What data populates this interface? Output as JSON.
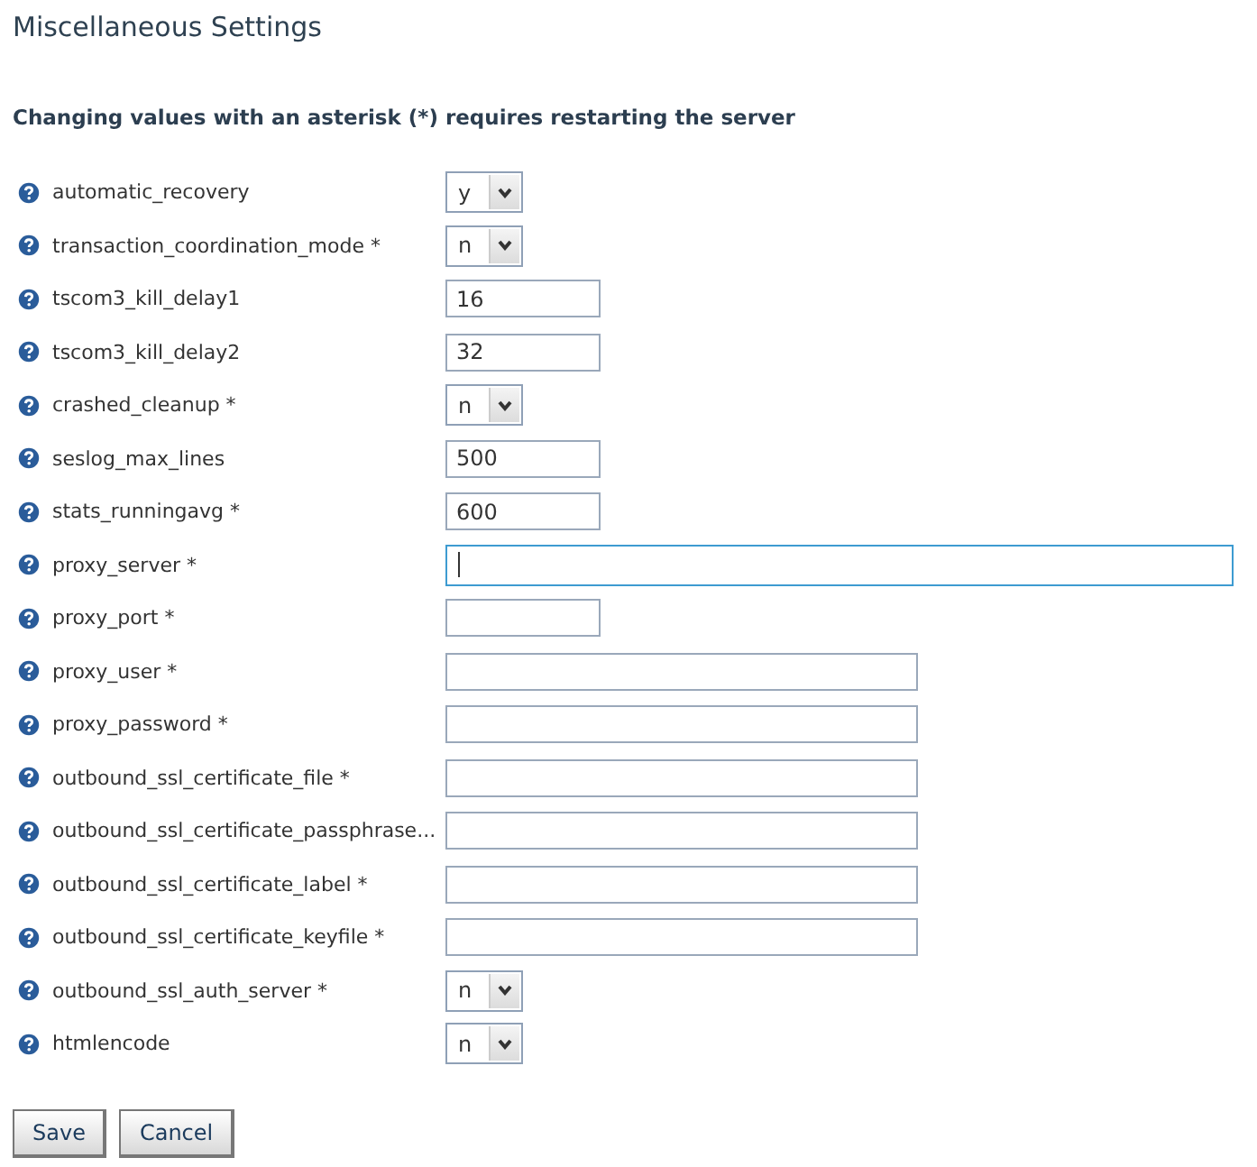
{
  "title": "Miscellaneous Settings",
  "notice": "Changing values with an asterisk (*) requires restarting the server",
  "settings": [
    {
      "label": "automatic_recovery",
      "kind": "select",
      "value": "y"
    },
    {
      "label": "transaction_coordination_mode *",
      "kind": "select",
      "value": "n"
    },
    {
      "label": "tscom3_kill_delay1",
      "kind": "short",
      "value": "16",
      "focused": false
    },
    {
      "label": "tscom3_kill_delay2",
      "kind": "short",
      "value": "32",
      "focused": false
    },
    {
      "label": "crashed_cleanup *",
      "kind": "select",
      "value": "n"
    },
    {
      "label": "seslog_max_lines",
      "kind": "short",
      "value": "500",
      "focused": false
    },
    {
      "label": "stats_runningavg *",
      "kind": "short",
      "value": "600",
      "focused": false
    },
    {
      "label": "proxy_server *",
      "kind": "wide",
      "focused": true
    },
    {
      "label": "proxy_port *",
      "kind": "short",
      "focused": false
    },
    {
      "label": "proxy_user *",
      "kind": "medium",
      "focused": false
    },
    {
      "label": "proxy_password *",
      "kind": "medium",
      "focused": false
    },
    {
      "label": "outbound_ssl_certificate_file *",
      "kind": "medium",
      "focused": false
    },
    {
      "label": "outbound_ssl_certificate_passphrase...",
      "kind": "medium",
      "focused": false
    },
    {
      "label": "outbound_ssl_certificate_label *",
      "kind": "medium",
      "focused": false
    },
    {
      "label": "outbound_ssl_certificate_keyfile *",
      "kind": "medium",
      "focused": false
    },
    {
      "label": "outbound_ssl_auth_server *",
      "kind": "select",
      "value": "n"
    },
    {
      "label": "htmlencode",
      "kind": "select",
      "value": "n"
    }
  ],
  "buttons": [
    "Save",
    "Cancel"
  ]
}
